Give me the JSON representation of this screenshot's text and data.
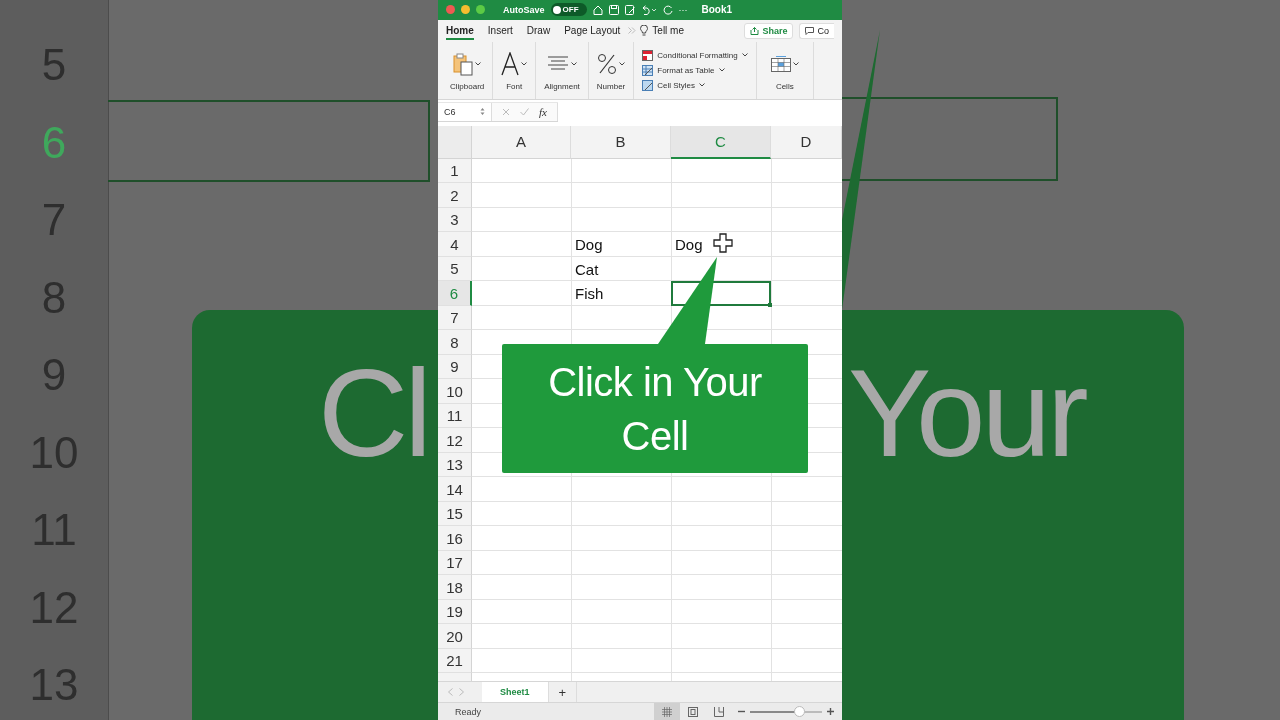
{
  "backdrop": {
    "row_numbers": [
      {
        "label": "5",
        "selected": false
      },
      {
        "label": "6",
        "selected": true
      },
      {
        "label": "7",
        "selected": false
      },
      {
        "label": "8",
        "selected": false
      },
      {
        "label": "9",
        "selected": false
      },
      {
        "label": "10",
        "selected": false
      },
      {
        "label": "11",
        "selected": false
      },
      {
        "label": "12",
        "selected": false
      },
      {
        "label": "13",
        "selected": false
      }
    ],
    "banner_left": "Cl",
    "banner_right": "Your"
  },
  "title_bar": {
    "autosave_label": "AutoSave",
    "autosave_toggle": {
      "on": false,
      "label": "OFF"
    },
    "more": "···",
    "document_title": "Book1"
  },
  "tabs": [
    {
      "label": "Home",
      "selected": true
    },
    {
      "label": "Insert",
      "selected": false
    },
    {
      "label": "Draw",
      "selected": false
    },
    {
      "label": "Page Layout",
      "selected": false
    }
  ],
  "tell_me": "Tell me",
  "share_button": "Share",
  "comments_button": "Co",
  "ribbon_groups": [
    {
      "label": "Clipboard",
      "kind": "clipboard"
    },
    {
      "label": "Font",
      "kind": "font"
    },
    {
      "label": "Alignment",
      "kind": "alignment"
    },
    {
      "label": "Number",
      "kind": "number"
    }
  ],
  "styles_menu": [
    {
      "label": "Conditional Formatting",
      "kind": "conditional"
    },
    {
      "label": "Format as Table",
      "kind": "table"
    },
    {
      "label": "Cell Styles",
      "kind": "styles"
    }
  ],
  "cells_group": {
    "label": "Cells"
  },
  "formula_bar": {
    "name_box": "C6",
    "function_label": "fx"
  },
  "columns": [
    {
      "label": "A",
      "selected": false
    },
    {
      "label": "B",
      "selected": false
    },
    {
      "label": "C",
      "selected": true
    },
    {
      "label": "D",
      "selected": false
    }
  ],
  "rows": [
    {
      "label": "1",
      "selected": false
    },
    {
      "label": "2",
      "selected": false
    },
    {
      "label": "3",
      "selected": false
    },
    {
      "label": "4",
      "selected": false,
      "column_b": "Dog",
      "column_c": "Dog"
    },
    {
      "label": "5",
      "selected": false,
      "column_b": "Cat"
    },
    {
      "label": "6",
      "selected": true,
      "column_b": "Fish"
    },
    {
      "label": "7",
      "selected": false
    },
    {
      "label": "8",
      "selected": false
    },
    {
      "label": "9",
      "selected": false
    },
    {
      "label": "10",
      "selected": false
    },
    {
      "label": "11",
      "selected": false
    },
    {
      "label": "12",
      "selected": false
    },
    {
      "label": "13",
      "selected": false
    },
    {
      "label": "14",
      "selected": false
    },
    {
      "label": "15",
      "selected": false
    },
    {
      "label": "16",
      "selected": false
    },
    {
      "label": "17",
      "selected": false
    },
    {
      "label": "18",
      "selected": false
    },
    {
      "label": "19",
      "selected": false
    },
    {
      "label": "20",
      "selected": false
    },
    {
      "label": "21",
      "selected": false
    }
  ],
  "sheet_tabs": [
    {
      "label": "Sheet1",
      "selected": true
    }
  ],
  "add_sheet": "+",
  "status_bar": {
    "status": "Ready",
    "views": [
      {
        "kind": "normal",
        "selected": true
      },
      {
        "kind": "page_layout",
        "selected": false
      },
      {
        "kind": "page_break",
        "selected": false
      }
    ],
    "zoom": {
      "level": 0.68
    }
  },
  "callout": {
    "text": "Click in Your Cell"
  }
}
